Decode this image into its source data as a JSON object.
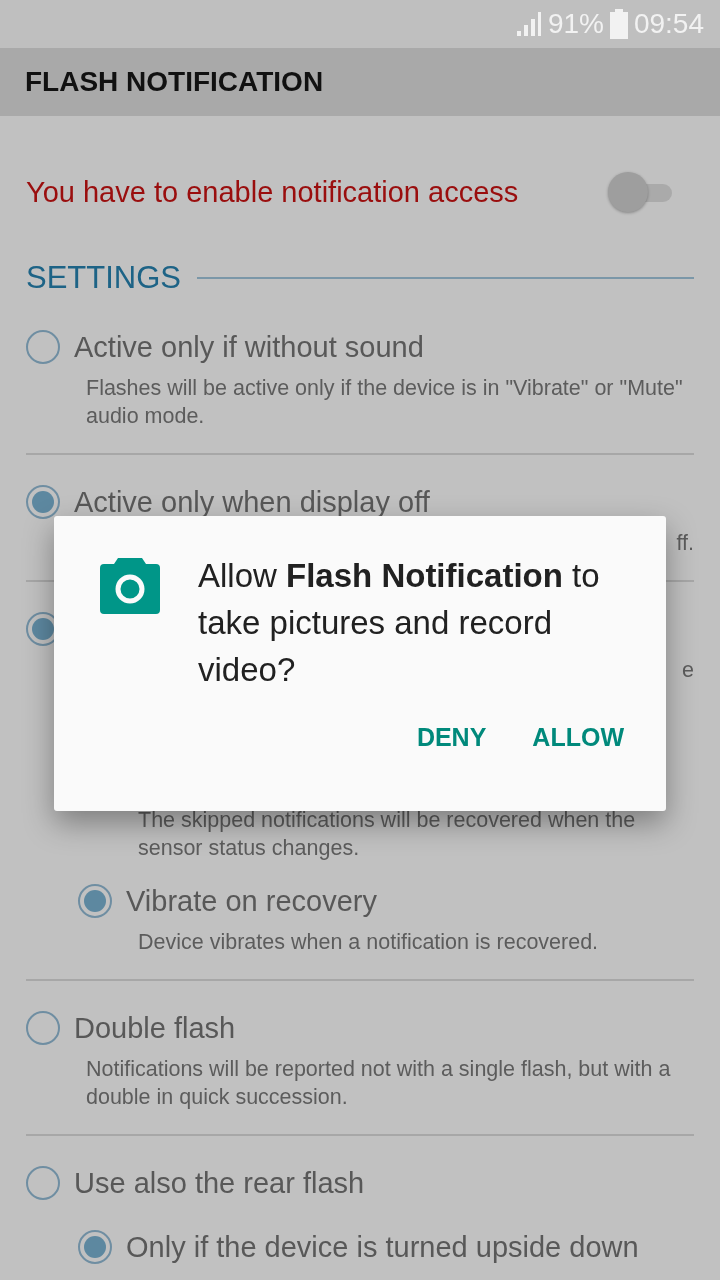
{
  "status_bar": {
    "battery": "91%",
    "time": "09:54"
  },
  "app_bar": {
    "title": "FLASH NOTIFICATION"
  },
  "access": {
    "label": "You have to enable notification access",
    "on": false
  },
  "section": {
    "title": "SETTINGS"
  },
  "options": [
    {
      "kind": "full",
      "title": "Active only if without sound",
      "description": "Flashes will be active only if the device is in \"Vibrate\" or \"Mute\" audio mode.",
      "selected": false
    },
    {
      "kind": "covered",
      "title": "Active only when display off",
      "description": "ff.",
      "selected": true
    },
    {
      "kind": "covered",
      "description": "e",
      "selected": true,
      "children": [
        {
          "kind": "full",
          "description": "The skipped notifications will be recovered when the sensor status changes."
        },
        {
          "kind": "full",
          "title": "Vibrate on recovery",
          "description": "Device vibrates when a notification is recovered.",
          "selected": true
        }
      ]
    },
    {
      "kind": "full",
      "title": "Double flash",
      "description": "Notifications will be reported not with a single flash, but with a double in quick succession.",
      "selected": false
    },
    {
      "kind": "full",
      "title": "Use also the rear flash",
      "selected": false,
      "children": [
        {
          "kind": "full",
          "title": "Only if the device is turned upside down",
          "selected": true
        }
      ]
    }
  ],
  "dialog": {
    "message": "Allow **Flash Notification** to take pictures and record video?",
    "buttons": [
      "DENY",
      "ALLOW"
    ]
  }
}
